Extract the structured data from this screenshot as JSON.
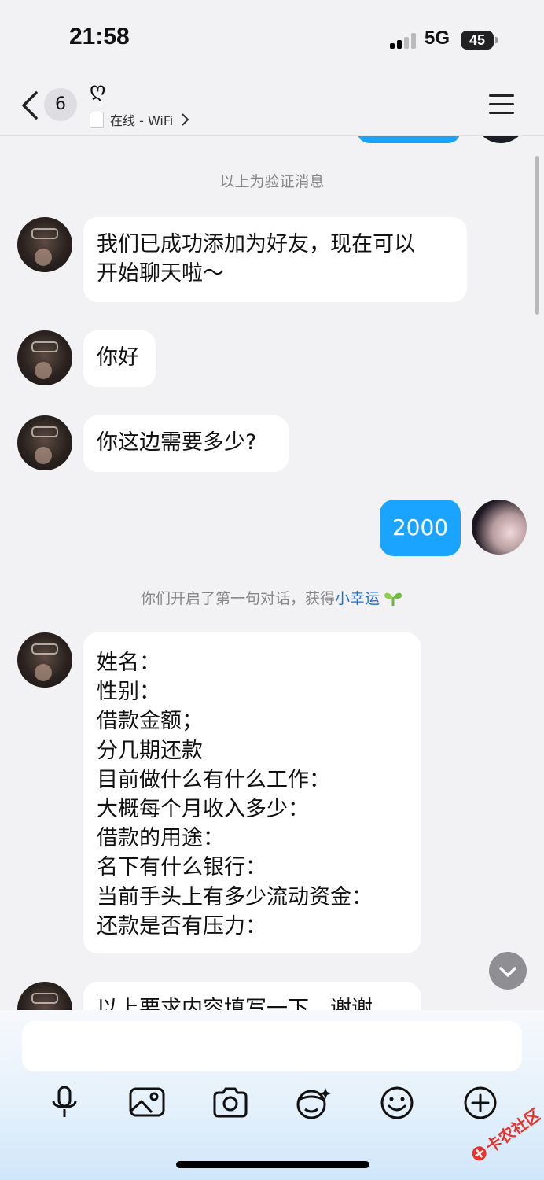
{
  "status_bar": {
    "time": "21:58",
    "network": "5G",
    "battery": "45"
  },
  "header": {
    "back_count": "6",
    "nickname": "ღ",
    "online_status": "在线 - WiFi"
  },
  "messages": {
    "system_verify": "以上为验证消息",
    "added_friend": [
      "我们已成功添加为好友，现在可以",
      "开始聊天啦～"
    ],
    "hello": "你好",
    "how_much": "你这边需要多少?",
    "my_reply": "2000",
    "system_first_chat_prefix": "你们开启了第一句对话，获得",
    "system_first_chat_link": "小幸运",
    "form_lines": [
      "姓名：",
      "性别：",
      "借款金额；",
      "分几期还款",
      "目前做什么有什么工作：",
      "大概每个月收入多少：",
      "借款的用途：",
      "名下有什么银行：",
      "当前手头上有多少流动资金：",
      "还款是否有压力："
    ],
    "partial_last": "以上要求内容填写一下，谢谢"
  },
  "toolbar": {
    "icons": [
      "microphone-icon",
      "image-icon",
      "camera-icon",
      "face-sticker-icon",
      "emoji-icon",
      "plus-icon"
    ]
  },
  "watermark": "卡农社区",
  "colors": {
    "accent": "#1aa3ff",
    "link": "#1e6fd6",
    "background": "#f2f2f4"
  }
}
